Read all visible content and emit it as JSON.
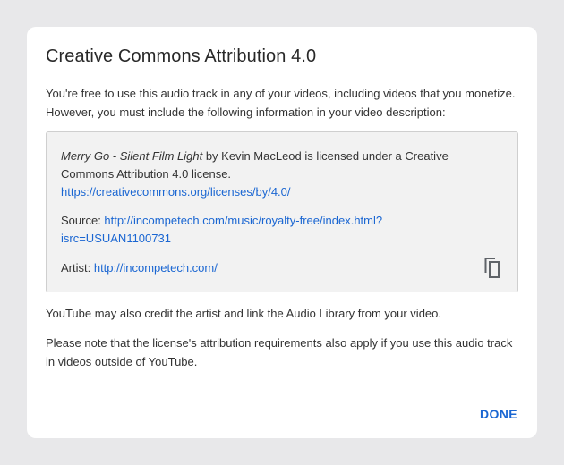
{
  "dialog": {
    "title": "Creative Commons Attribution 4.0",
    "intro": "You're free to use this audio track in any of your videos, including videos that you monetize. However, you must include the following information in your video description:",
    "attribution": {
      "track_title": "Merry Go - Silent Film Light",
      "credit_text": " by Kevin MacLeod is licensed under a Creative Commons Attribution 4.0 license.",
      "license_url": "https://creativecommons.org/licenses/by/4.0/",
      "source_label": "Source: ",
      "source_url": "http://incompetech.com/music/royalty-free/index.html?isrc=USUAN1100731",
      "artist_label": "Artist: ",
      "artist_url": "http://incompetech.com/",
      "copy_icon": "copy-icon"
    },
    "note_credit": "YouTube may also credit the artist and link the Audio Library from your video.",
    "note_license": "Please note that the license's attribution requirements also apply if you use this audio track in videos outside of YouTube.",
    "done_label": "DONE"
  },
  "colors": {
    "link": "#1a66d2",
    "backdrop": "#e8e8ea",
    "attribution_bg": "#f2f2f2"
  }
}
